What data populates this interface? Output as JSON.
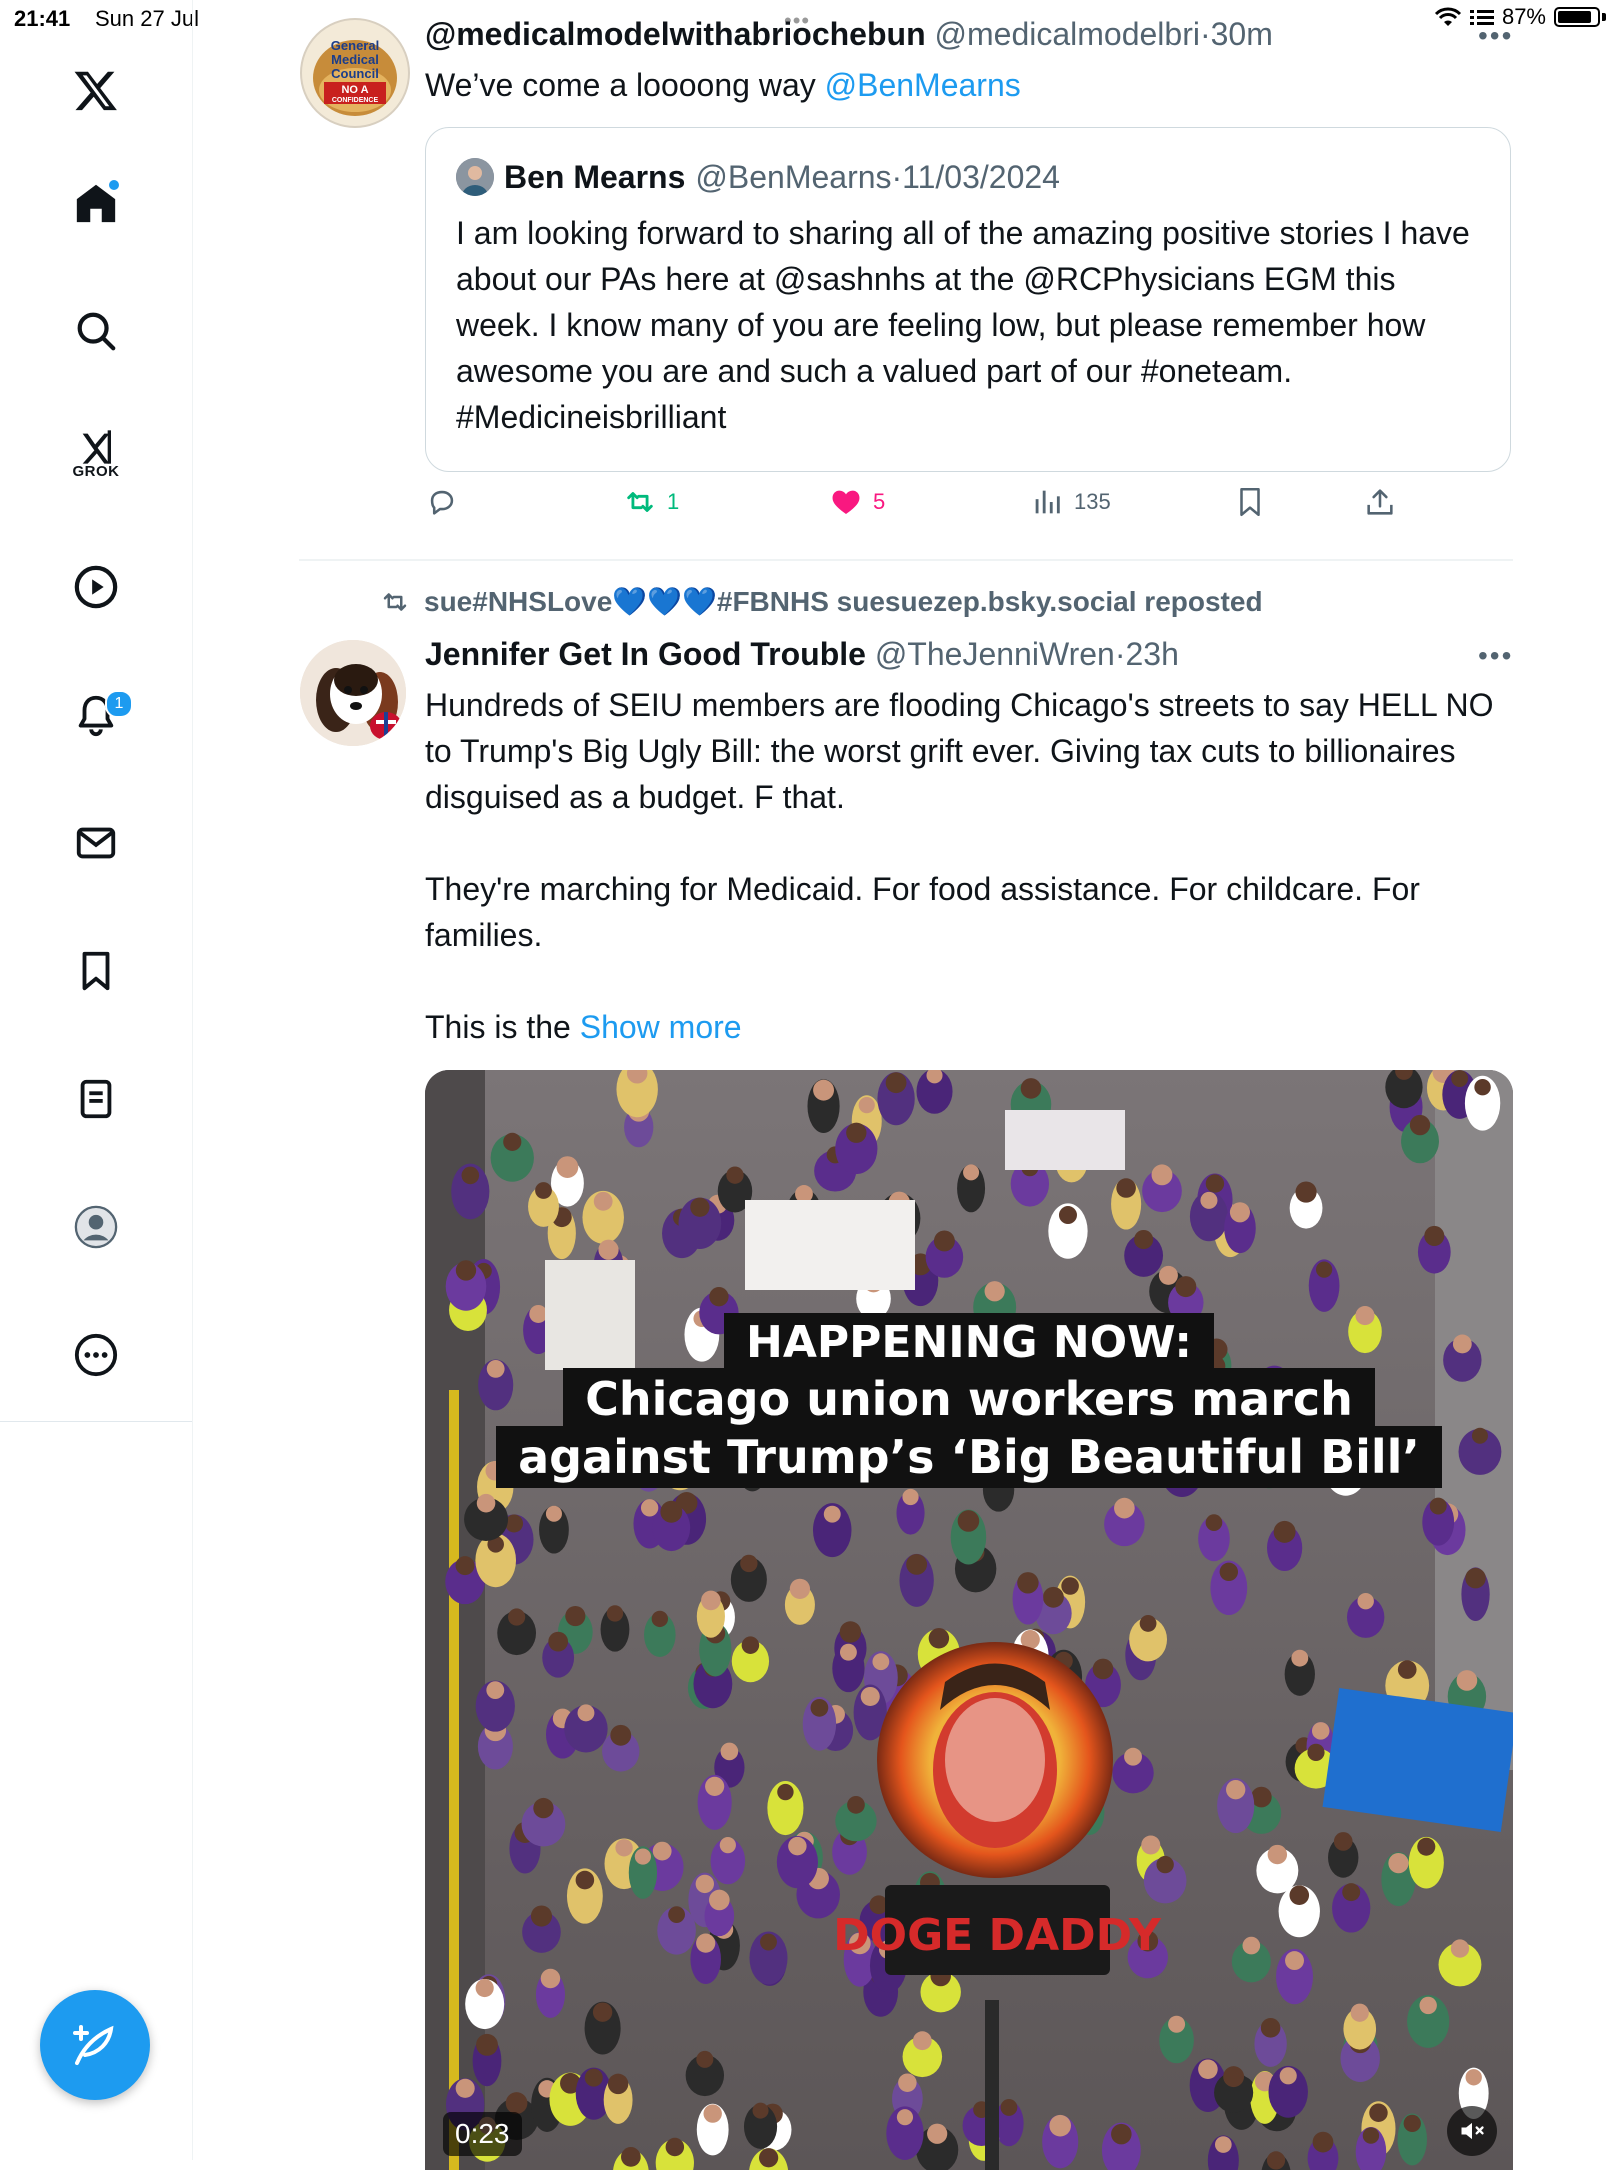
{
  "status_bar": {
    "time": "21:41",
    "date": "Sun 27 Jul",
    "battery": "87%",
    "battery_level": 0.87
  },
  "sidebar": {
    "logo": "x-logo-icon",
    "items": [
      {
        "name": "home",
        "icon": "home-icon"
      },
      {
        "name": "explore",
        "icon": "search-icon"
      },
      {
        "name": "grok",
        "icon": "grok-icon",
        "label": "GROK"
      },
      {
        "name": "video",
        "icon": "play-icon"
      },
      {
        "name": "notifications",
        "icon": "bell-icon",
        "badge": "1"
      },
      {
        "name": "messages",
        "icon": "mail-icon"
      },
      {
        "name": "bookmarks",
        "icon": "bookmark-icon"
      },
      {
        "name": "lists",
        "icon": "list-icon"
      },
      {
        "name": "profile",
        "icon": "user-icon"
      },
      {
        "name": "more",
        "icon": "more-icon"
      }
    ],
    "compose_icon": "compose-icon"
  },
  "tweet1": {
    "display_name": "@medicalmodelwithabriochebun",
    "handle": "@medicalmodelbri",
    "separator": "·",
    "time": "30m",
    "text_before": "We’ve come a loooong way ",
    "mention": "@BenMearns",
    "avatar_text": [
      "General",
      "Medical",
      "Council",
      "NO A",
      "CONFIDENCE"
    ],
    "quote": {
      "display_name": "Ben Mearns",
      "handle": "@BenMearns",
      "separator": "·",
      "date": "11/03/2024",
      "text": "I am looking forward to sharing all of the amazing positive stories I have about our PAs here at @sashnhs at the @RCPhysicians EGM this week. I know many of you are feeling low, but please remember how awesome you are and such a valued part of our #oneteam. #Medicineisbrilliant"
    },
    "actions": {
      "reply_count": "",
      "retweet_count": "1",
      "like_count": "5",
      "views_count": "135"
    }
  },
  "tweet2": {
    "social_context": "sue#NHSLove💙💙💙#FBNHS suesuezep.bsky.social reposted",
    "display_name": "Jennifer Get In Good Trouble",
    "handle": "@TheJenniWren",
    "separator": "·",
    "time": "23h",
    "paragraph1": "Hundreds of SEIU members are flooding Chicago's streets to say HELL NO to Trump's Big Ugly Bill: the worst grift ever. Giving tax cuts to billionaires disguised as a budget. F that.",
    "paragraph2": "They're marching for Medicaid. For food assistance. For childcare. For families.",
    "paragraph3_start": "This is the ",
    "show_more": "Show more",
    "video": {
      "caption_line1": "HAPPENING NOW:",
      "caption_line2": "Chicago union workers march",
      "caption_line3": "against Trump’s ‘Big Beautiful Bill’",
      "sign_text": "DOGE DADDY",
      "duration": "0:23",
      "mute_icon": "speaker-muted-icon"
    }
  },
  "colors": {
    "accent": "#1d9bf0",
    "like": "#f91880",
    "retweet": "#00ba7c",
    "muted_text": "#536471"
  }
}
